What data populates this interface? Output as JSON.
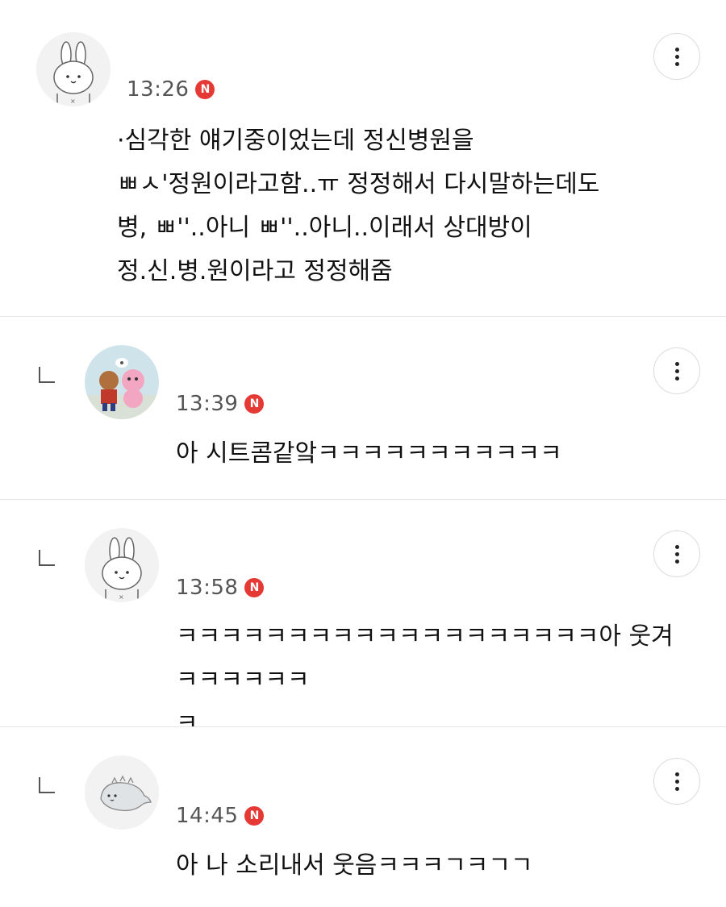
{
  "comments": [
    {
      "time": "13:26",
      "badge": "N",
      "text": "·심각한 얘기중이었는데 정신병원을\nㅃㅅ'정원이라고함..ㅠ 정정해서 다시말하는데도\n병, ㅃ''..아니 ㅃ''..아니..이래서 상대방이\n정.신.병.원이라고 정정해줌",
      "avatar_icon": "bunny-avatar-icon",
      "is_reply": false
    },
    {
      "time": "13:39",
      "badge": "N",
      "text": "아 시트콤같앜ㅋㅋㅋㅋㅋㅋㅋㅋㅋㅋㅋ",
      "avatar_icon": "game-characters-avatar-icon",
      "is_reply": true
    },
    {
      "time": "13:58",
      "badge": "N",
      "text": "ㅋㅋㅋㅋㅋㅋㅋㅋㅋㅋㅋㅋㅋㅋㅋㅋㅋㅋㅋ아 웃겨 ㅋㅋㅋㅋㅋㅋ\nㅋ",
      "avatar_icon": "bunny-avatar-icon",
      "is_reply": true
    },
    {
      "time": "14:45",
      "badge": "N",
      "text": "아 나 소리내서 웃음ㅋㅋㅋㄱㅋㄱㄱ",
      "avatar_icon": "dino-avatar-icon",
      "is_reply": true
    }
  ],
  "colors": {
    "badge": "#e53935",
    "divider": "#e6e6e6",
    "time": "#555555"
  },
  "icons": {
    "more": "more-vertical-icon",
    "reply": "reply-arrow-icon"
  }
}
